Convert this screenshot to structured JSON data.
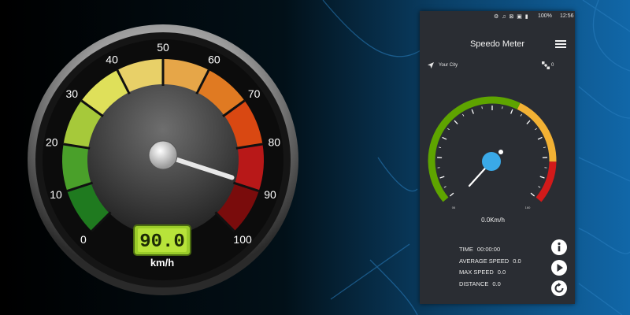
{
  "left_gauge": {
    "dial_labels": [
      "0",
      "10",
      "20",
      "30",
      "40",
      "50",
      "60",
      "70",
      "80",
      "90",
      "100"
    ],
    "digital_readout": "90.0",
    "unit": "km/h",
    "speed": 90
  },
  "phone": {
    "status": {
      "battery": "100%",
      "time": "12:56"
    },
    "app_title": "Speedo Meter",
    "location_label": "Your City",
    "satellite_count": "0",
    "gauge": {
      "min_label": "06",
      "max_label": "160",
      "speed": 0
    },
    "speed_readout": "0.0Km/h",
    "stats": [
      {
        "label": "TIME",
        "value": "00:00:00"
      },
      {
        "label": "AVERAGE SPEED",
        "value": "0.0"
      },
      {
        "label": "MAX SPEED",
        "value": "0.0"
      },
      {
        "label": "DISTANCE",
        "value": "0.0"
      }
    ],
    "buttons": [
      "info-icon",
      "play-icon",
      "refresh-icon"
    ]
  },
  "colors": {
    "accent_green": "#5ea400",
    "accent_yellow": "#f2b134",
    "accent_red": "#d21a1a",
    "needle_blue": "#3aa9e8"
  }
}
